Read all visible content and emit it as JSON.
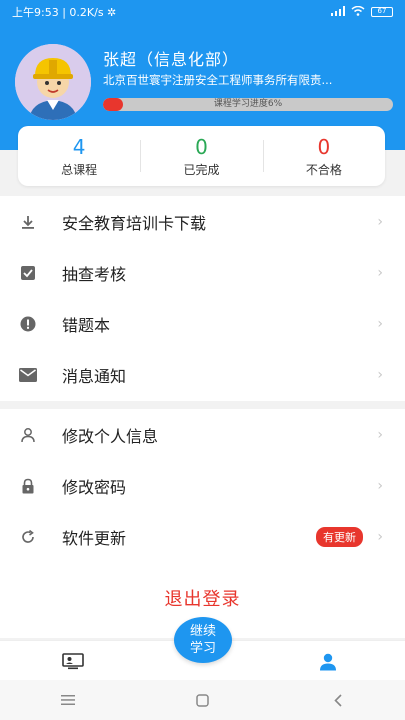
{
  "status_bar": {
    "left": "上午9:53 | 0.2K/s ✲",
    "battery": "67"
  },
  "profile": {
    "name": "张超（信息化部）",
    "organization": "北京百世寰宇注册安全工程师事务所有限责...",
    "progress_text": "课程学习进度6%",
    "progress_fraction": 0.06
  },
  "stats": [
    {
      "value": "4",
      "label": "总课程",
      "color": "#1e96f0"
    },
    {
      "value": "0",
      "label": "已完成",
      "color": "#2aa855"
    },
    {
      "value": "0",
      "label": "不合格",
      "color": "#e8362d"
    }
  ],
  "menu_group_1": [
    {
      "label": "安全教育培训卡下载",
      "icon": "download-icon"
    },
    {
      "label": "抽查考核",
      "icon": "check-square-icon"
    },
    {
      "label": "错题本",
      "icon": "alert-circle-icon"
    },
    {
      "label": "消息通知",
      "icon": "mail-icon"
    }
  ],
  "menu_group_2": [
    {
      "label": "修改个人信息",
      "icon": "user-icon"
    },
    {
      "label": "修改密码",
      "icon": "lock-icon"
    },
    {
      "label": "软件更新",
      "icon": "refresh-icon",
      "badge": "有更新"
    }
  ],
  "logout_label": "退出登录",
  "fab_label": "继续\n学习",
  "tabbar": {
    "left_icon": "courses-icon",
    "right_icon": "profile-icon",
    "active_color": "#1e96f0"
  },
  "colors": {
    "primary": "#1e96f0",
    "danger": "#e8362d",
    "success": "#2aa855"
  }
}
